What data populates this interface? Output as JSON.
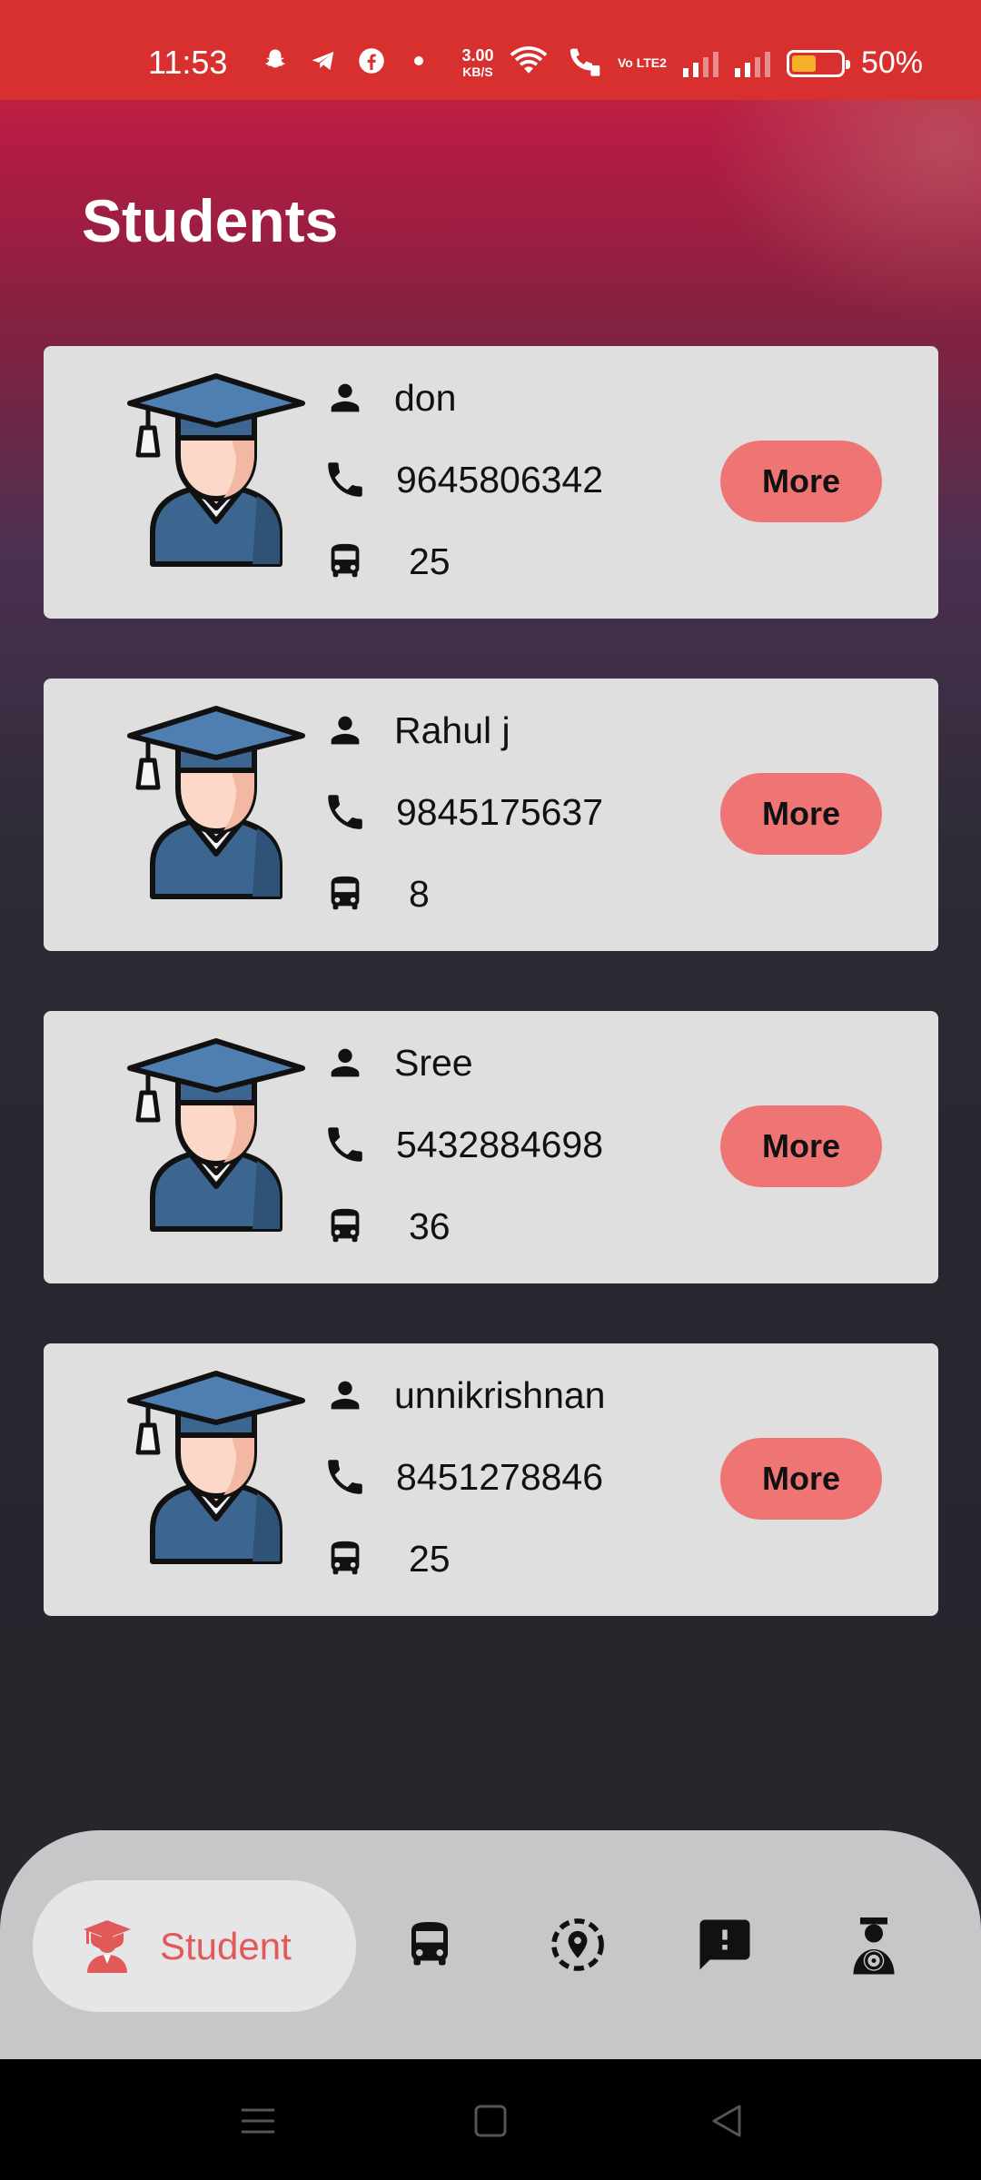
{
  "status_bar": {
    "time": "11:53",
    "network_speed_value": "3.00",
    "network_speed_unit": "KB/S",
    "volte_label": "Vo LTE2",
    "battery_percent": "50%",
    "battery_level": 0.5,
    "notification_icons": [
      "snapchat-icon",
      "telegram-icon",
      "facebook-icon",
      "dot-icon"
    ]
  },
  "header": {
    "title": "Students"
  },
  "students": [
    {
      "name": "don",
      "phone": "9645806342",
      "bus": "25",
      "more_label": "More"
    },
    {
      "name": "Rahul j",
      "phone": "9845175637",
      "bus": "8",
      "more_label": "More"
    },
    {
      "name": "Sree",
      "phone": "5432884698",
      "bus": "36",
      "more_label": "More"
    },
    {
      "name": "unnikrishnan",
      "phone": "8451278846",
      "bus": "25",
      "more_label": "More"
    }
  ],
  "bottom_nav": {
    "active_label": "Student",
    "items": [
      "student-icon",
      "bus-icon",
      "location-icon",
      "feedback-icon",
      "driver-icon"
    ]
  },
  "colors": {
    "status_bar": "#d7302e",
    "card_bg": "#e0dfe0",
    "more_button": "#ef7574",
    "nav_active_text": "#e2595a",
    "nav_bg": "#c7c7ca"
  }
}
